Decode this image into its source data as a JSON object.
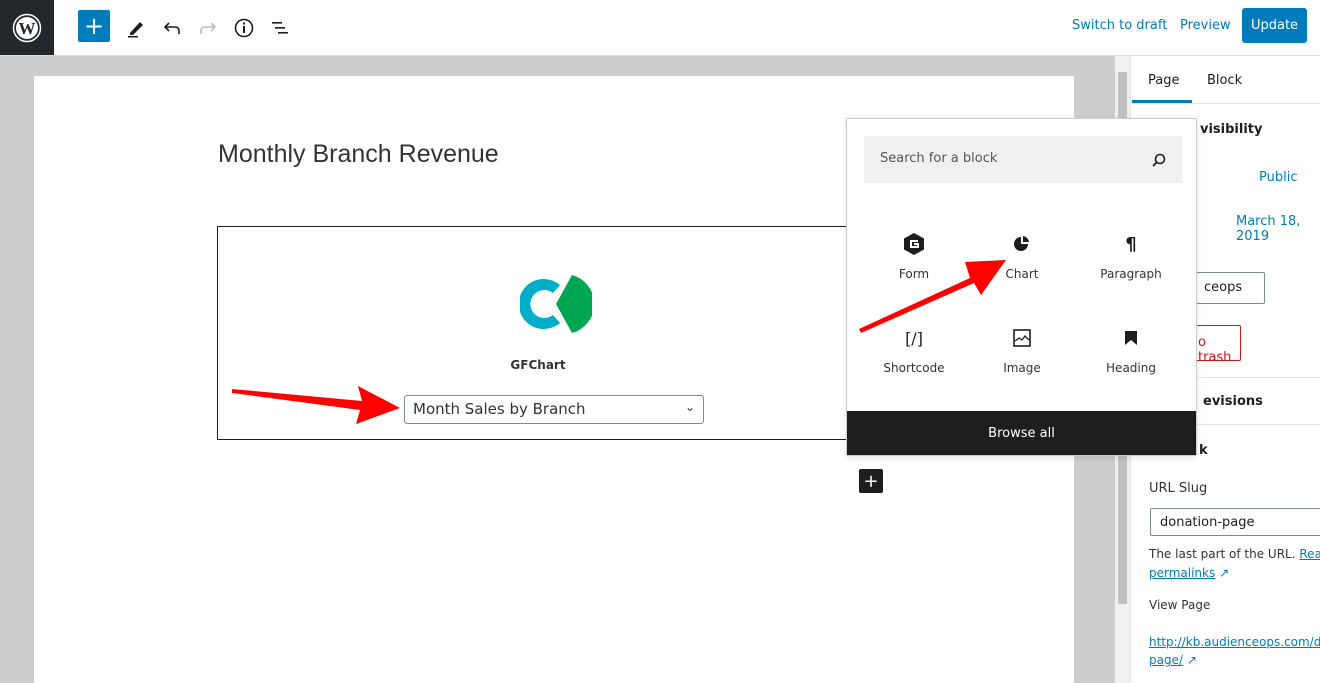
{
  "toolbar": {
    "switch_draft": "Switch to draft",
    "preview": "Preview",
    "update": "Update",
    "add": "+"
  },
  "editor": {
    "title": "Monthly Branch Revenue",
    "block_name": "GFChart",
    "selected_chart": "Month Sales by Branch"
  },
  "inserter": {
    "search_placeholder": "Search for a block",
    "blocks": [
      {
        "label": "Form",
        "icon": "gravity-forms-icon"
      },
      {
        "label": "Chart",
        "icon": "pie-chart-icon"
      },
      {
        "label": "Paragraph",
        "icon": "pilcrow-icon"
      },
      {
        "label": "Shortcode",
        "icon": "shortcode-icon"
      },
      {
        "label": "Image",
        "icon": "image-icon"
      },
      {
        "label": "Heading",
        "icon": "bookmark-icon"
      }
    ],
    "browse_all": "Browse all"
  },
  "sidebar": {
    "tabs": [
      "Page",
      "Block"
    ],
    "visibility_fragment": "visibility",
    "visibility_value": "Public",
    "publish_date": "March 18, 2019",
    "author_fragment": "ceops",
    "trash_fragment": "o trash",
    "revisions_fragment": "evisions",
    "permalink_fragment": "k",
    "url_slug_label": "URL Slug",
    "url_slug_value": "donation-page",
    "help_text": "The last part of the URL.",
    "read_link": "Read",
    "permalinks_link": "permalinks",
    "view_page_label": "View Page",
    "view_url_1": "http://kb.audienceops.com/do",
    "view_url_2": "page/"
  },
  "colors": {
    "accent": "#007cba",
    "arrow": "#ff0000",
    "logo_teal": "#00aec9",
    "logo_green": "#00a651"
  }
}
